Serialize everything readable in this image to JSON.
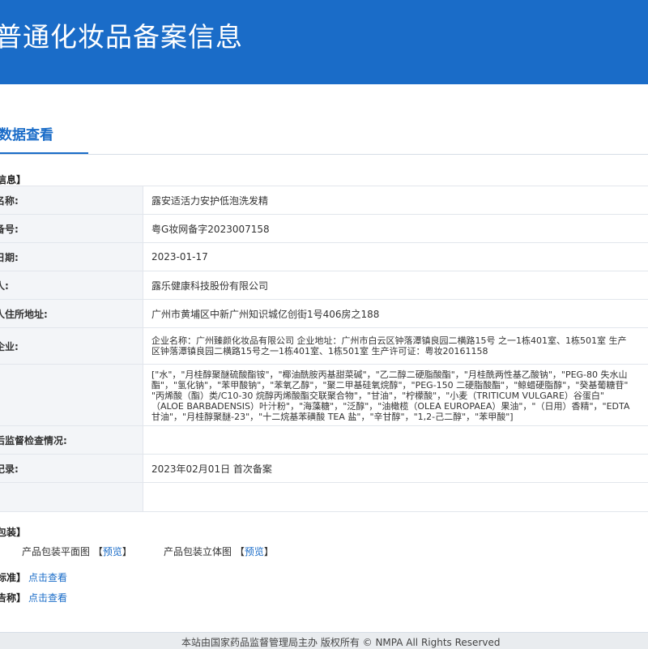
{
  "header": {
    "title": "普通化妆品备案信息"
  },
  "tab": {
    "label": "数据查看"
  },
  "section_basic": "信息】",
  "rows": [
    {
      "label": "名称:",
      "value": "露安适活力安护低泡洗发精"
    },
    {
      "label": "备号:",
      "value": "粤G妆网备字2023007158"
    },
    {
      "label": "日期:",
      "value": "2023-01-17"
    },
    {
      "label": "人:",
      "value": "露乐健康科技股份有限公司"
    },
    {
      "label": "人住所地址:",
      "value": "广州市黄埔区中新广州知识城亿创街1号406房之188"
    },
    {
      "label": "企业:",
      "lines": [
        "企业名称：广州臻颜化妆品有限公司 企业地址：广州市白云区钟落潭镇良园二横路15号 之一1栋401室、1栋501室 生产",
        "区钟落潭镇良园二横路15号之一1栋401室、1栋501室 生产许可证：粤妆20161158"
      ]
    },
    {
      "label": "",
      "lines": [
        "[\"水\"，\"月桂醇聚醚硫酸酯铵\"，\"椰油酰胺丙基甜菜碱\"，\"乙二醇二硬脂酸酯\"，\"月桂酰两性基乙酸钠\"，\"PEG-80 失水山",
        "酯\"，\"氢化钠\"，\"苯甲酸钠\"，\"苯氧乙醇\"，\"聚二甲基硅氧烷醇\"，\"PEG-150 二硬脂酸酯\"，\"鲸蜡硬脂醇\"，\"癸基葡糖苷\"",
        "\"丙烯酸（酯）类/C10-30 烷醇丙烯酸酯交联聚合物\"，\"甘油\"，\"柠檬酸\"，\"小麦（TRITICUM VULGARE）谷蛋白\"",
        "（ALOE BARBADENSIS）叶汁粉\"，\"海藻糖\"，\"泛醇\"，\"油橄榄（OLEA EUROPAEA）果油\"，\"（日用）香精\"，\"EDTA",
        "甘油\"，\"月桂醇聚醚-23\"，\"十二烷基苯磺酸 TEA 盐\"，\"辛甘醇\"，\"1,2-己二醇\"，\"苯甲酸\"]"
      ]
    },
    {
      "label": "后监督检查情况:",
      "value": ""
    },
    {
      "label": "记录:",
      "value": "2023年02月01日 首次备案"
    },
    {
      "label": "",
      "value": ""
    }
  ],
  "section_pkg": "包装】",
  "pkg": {
    "flat_label": "产品包装平面图",
    "flat_open": "【",
    "flat_link": "预览",
    "flat_close": "】",
    "stereo_label": "产品包装立体图",
    "stereo_open": "【",
    "stereo_link": "预览",
    "stereo_close": "】"
  },
  "standard": {
    "label": "标准】",
    "link": "点击查看"
  },
  "report": {
    "label": "告称】",
    "link": "点击查看"
  },
  "footer": {
    "text": "本站由国家药品监督管理局主办 版权所有 © NMPA All Rights Reserved"
  },
  "colors": {
    "brand": "#1a6cc8",
    "label_bg": "#f3f5f8"
  }
}
